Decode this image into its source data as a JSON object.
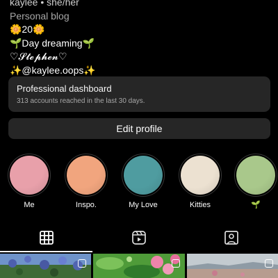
{
  "profile": {
    "name_line": "kaylee • she/her",
    "category": "Personal blog",
    "bio_lines": [
      "🌼20🌼",
      "🌱Day dreaming🌱",
      "♡𝓢𝓽𝓮𝓹𝓱𝓮𝓷♡",
      "✨@kaylee.oops✨"
    ]
  },
  "dashboard": {
    "title": "Professional dashboard",
    "subtitle": "313 accounts reached in the last 30 days."
  },
  "edit_profile_label": "Edit profile",
  "highlights": [
    {
      "label": "Me",
      "color": "#e8a0aa"
    },
    {
      "label": "Inspo.",
      "color": "#f1a57e"
    },
    {
      "label": "My Love",
      "color": "#4f9ca0"
    },
    {
      "label": "Kitties",
      "color": "#ece1d1"
    },
    {
      "label": "🌱",
      "color": "#a9c88b"
    }
  ],
  "tabs": [
    {
      "icon": "grid-icon",
      "active": true
    },
    {
      "icon": "reels-icon",
      "active": false
    },
    {
      "icon": "tagged-icon",
      "active": false
    }
  ],
  "posts": [
    {
      "subject": "lupine flowers",
      "colors": [
        "#5a7ab8",
        "#3d6a3a",
        "#8fb0d8"
      ]
    },
    {
      "subject": "pink flowers",
      "colors": [
        "#3c8a2e",
        "#e97aa4",
        "#6db54a"
      ]
    },
    {
      "subject": "coastal landscape",
      "colors": [
        "#b9c3c9",
        "#c9a89a",
        "#8c9aa6"
      ]
    }
  ]
}
